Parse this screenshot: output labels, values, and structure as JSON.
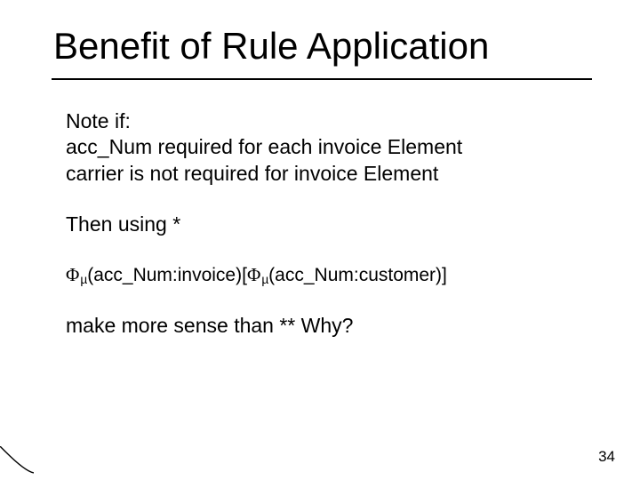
{
  "title": "Benefit of Rule Application",
  "body": {
    "note_label": "Note if:",
    "line1": "acc_Num required for each invoice Element",
    "line2": "carrier  is not required for invoice Element",
    "then": "Then using *",
    "formula": {
      "phi": "Φ",
      "mu": "µ",
      "f1_inner": "(acc_Num:invoice)[",
      "f2_inner": "(acc_Num:customer)]"
    },
    "conclusion": "make more sense than **  Why?"
  },
  "page_number": "34"
}
